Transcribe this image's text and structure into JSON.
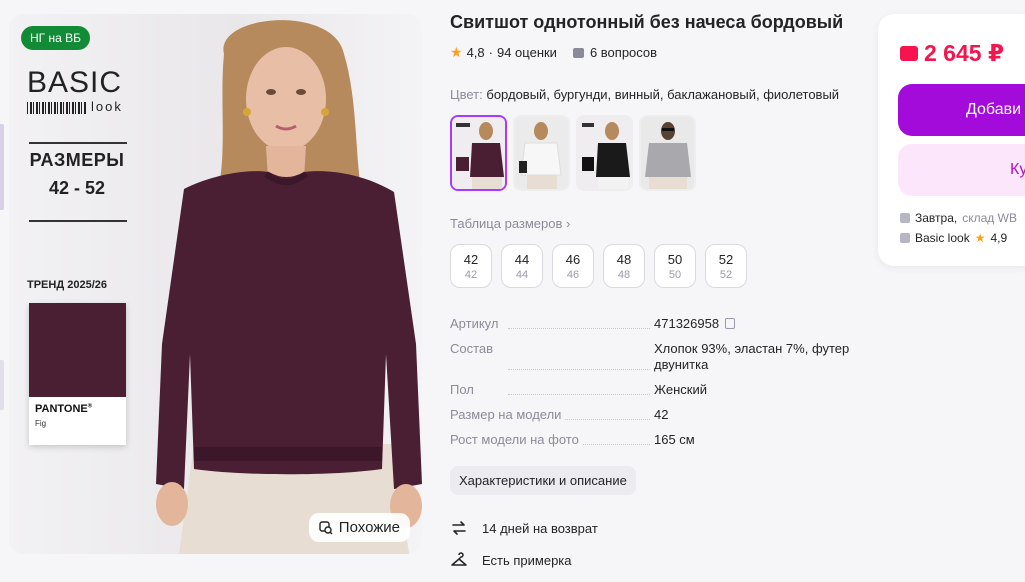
{
  "gallery": {
    "badge": "НГ на ВБ",
    "brand_top": "BASIC",
    "brand_sub": "look",
    "sizes_title": "РАЗМЕРЫ",
    "sizes_range": "42 - 52",
    "trend": "ТРЕНД 2025/26",
    "pantone_name": "PANTONE",
    "pantone_color_name": "Fig",
    "similar_label": "Похожие",
    "garment_color": "#4a1e33"
  },
  "product": {
    "title": "Свитшот однотонный без начеса бордовый",
    "rating": "4,8",
    "reviews": "94 оценки",
    "questions": "6 вопросов",
    "color_label": "Цвет:",
    "color_value": "бордовый, бургунди, винный, баклажановый, фиолетовый",
    "size_table_link": "Таблица размеров",
    "sizes": [
      {
        "main": "42",
        "sub": "42"
      },
      {
        "main": "44",
        "sub": "44"
      },
      {
        "main": "46",
        "sub": "46"
      },
      {
        "main": "48",
        "sub": "48"
      },
      {
        "main": "50",
        "sub": "50"
      },
      {
        "main": "52",
        "sub": "52"
      }
    ],
    "specs": [
      {
        "k": "Артикул",
        "v": "471326958"
      },
      {
        "k": "Состав",
        "v": "Хлопок 93%, эластан 7%, футер двунитка"
      },
      {
        "k": "Пол",
        "v": "Женский"
      },
      {
        "k": "Размер на модели",
        "v": "42"
      },
      {
        "k": "Рост модели на фото",
        "v": "165 см"
      }
    ],
    "characteristics_button": "Характеристики и описание",
    "features": [
      {
        "label": "14 дней на возврат"
      },
      {
        "label": "Есть примерка"
      }
    ]
  },
  "buy": {
    "price": "2 645 ₽",
    "add_to_cart": "Добави",
    "buy_now": "Купи",
    "delivery": "Завтра,",
    "delivery_muted": "склад WB",
    "seller": "Basic look",
    "seller_rating": "4,9"
  },
  "colors": {
    "accent": "#a73afd",
    "cart_button": "#a20bd9",
    "price": "#f5144e",
    "star": "#ff9e1a",
    "badge": "#138a36"
  }
}
